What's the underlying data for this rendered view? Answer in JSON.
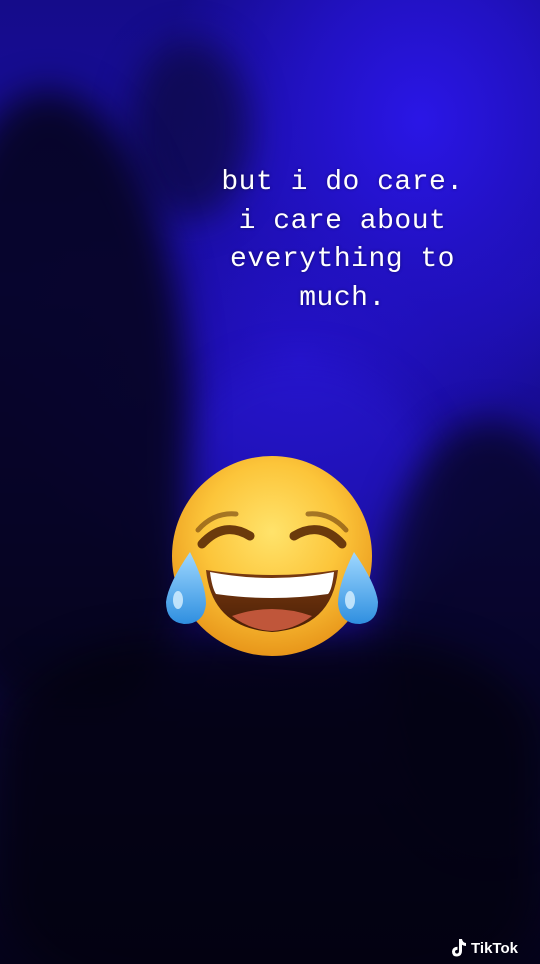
{
  "caption": {
    "lines": [
      "but i do care.",
      "i care about",
      "everything to",
      "much."
    ]
  },
  "emoji": {
    "icon": "face-with-tears-of-joy-icon"
  },
  "watermark": {
    "icon": "tiktok-logo-icon",
    "text": "TikTok"
  },
  "colors": {
    "background_blue": "#1a0fa6",
    "caption_text": "#ffffff"
  }
}
